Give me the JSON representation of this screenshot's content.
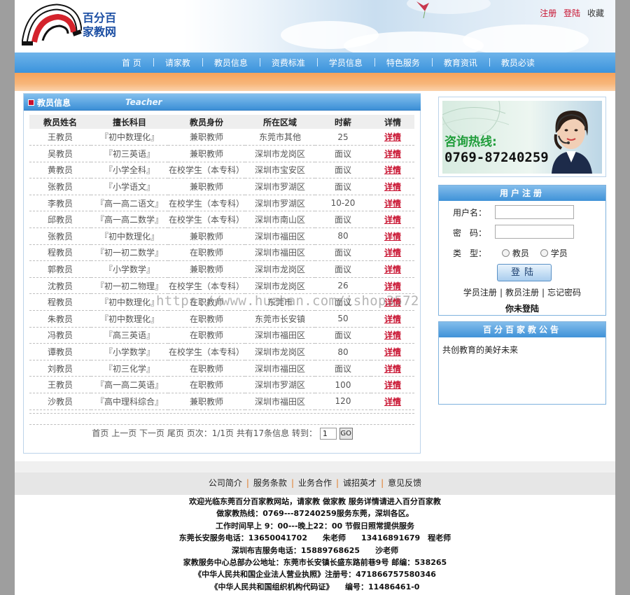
{
  "brand": {
    "line1": "百分百",
    "line2": "家教网"
  },
  "toplinks": {
    "register": "注册",
    "login": "登陆",
    "favorite": "收藏"
  },
  "nav": [
    "首 页",
    "请家教",
    "教员信息",
    "资费标准",
    "学员信息",
    "特色服务",
    "教育资讯",
    "教员必读"
  ],
  "panel": {
    "title": "教员信息",
    "subtitle": "Teacher"
  },
  "table": {
    "headers": [
      "教员姓名",
      "擅长科目",
      "教员身份",
      "所在区域",
      "时薪",
      "详情"
    ],
    "detail_label": "详情",
    "rows": [
      [
        "王教员",
        "『初中数理化』",
        "兼职教师",
        "东莞市其他",
        "25"
      ],
      [
        "吴教员",
        "『初三英语』",
        "兼职教师",
        "深圳市龙岗区",
        "面议"
      ],
      [
        "黄教员",
        "『小学全科』",
        "在校学生（本专科）",
        "深圳市宝安区",
        "面议"
      ],
      [
        "张教员",
        "『小学语文』",
        "兼职教师",
        "深圳市罗湖区",
        "面议"
      ],
      [
        "李教员",
        "『高一高二语文』",
        "在校学生（本专科）",
        "深圳市罗湖区",
        "10-20"
      ],
      [
        "邱教员",
        "『高一高二数学』",
        "在校学生（本专科）",
        "深圳市南山区",
        "面议"
      ],
      [
        "张教员",
        "『初中数理化』",
        "兼职教师",
        "深圳市福田区",
        "80"
      ],
      [
        "程教员",
        "『初一初二数学』",
        "在职教师",
        "深圳市福田区",
        "面议"
      ],
      [
        "郭教员",
        "『小学数学』",
        "兼职教师",
        "深圳市龙岗区",
        "面议"
      ],
      [
        "沈教员",
        "『初一初二物理』",
        "在校学生（本专科）",
        "深圳市龙岗区",
        "26"
      ],
      [
        "程教员",
        "『初中数理化』",
        "在职教师",
        "东莞市",
        "面议"
      ],
      [
        "朱教员",
        "『初中数理化』",
        "在职教师",
        "东莞市长安镇",
        "50"
      ],
      [
        "冯教员",
        "『高三英语』",
        "在职教师",
        "深圳市福田区",
        "面议"
      ],
      [
        "谭教员",
        "『小学数学』",
        "在校学生（本专科）",
        "深圳市龙岗区",
        "80"
      ],
      [
        "刘教员",
        "『初三化学』",
        "在职教师",
        "深圳市福田区",
        "面议"
      ],
      [
        "王教员",
        "『高一高二英语』",
        "在职教师",
        "深圳市罗湖区",
        "100"
      ],
      [
        "沙教员",
        "『高中理科综合』",
        "兼职教师",
        "深圳市福田区",
        "120"
      ]
    ]
  },
  "pager": {
    "first": "首页",
    "prev": "上一页",
    "next": "下一页",
    "last": "尾页",
    "page_info": "页次：1/1页",
    "total": "共有17条信息",
    "goto": "转到：",
    "page_value": "1",
    "go": "GO"
  },
  "hotline": {
    "label": "咨询热线:",
    "number": "0769-87240259"
  },
  "register_box": {
    "title": "用户注册",
    "username_label": "用户名：",
    "password_label": "密　码：",
    "type_label": "类　型：",
    "type_options": [
      "教员",
      "学员"
    ],
    "login_button": "登陆",
    "links": [
      "学员注册",
      "教员注册",
      "忘记密码"
    ],
    "status": "你未登陆"
  },
  "notice_box": {
    "title": "百分百家教公告",
    "body": "共创教育的美好未来"
  },
  "footer_nav": [
    "公司简介",
    "服务条款",
    "业务合作",
    "诚招英才",
    "意见反馈"
  ],
  "footer_info": [
    "欢迎光临东莞百分百家教网站，请家教 做家教 服务详情请进入百分百家教",
    "做家教热线：0769---87240259服务东莞，深圳各区。",
    "工作时间早上 9：00---晚上22：00 节假日照常提供服务",
    "东莞长安服务电话：13650041702　　朱老师　　13416891679　程老师",
    "深圳布吉服务电话：15889768625　　沙老师",
    "家教服务中心总部办公地址：东莞市长安镇长盛东路前巷9号 邮编：538265",
    "《中华人民共和国企业法人营业执照》注册号：471866757580346",
    "《中华人民共和国组织机构代码证》　　编号：11486461-0"
  ],
  "watermark": "https://www.huzhan.com/ishop3572",
  "colors": {
    "nav_blue": "#3b93dc",
    "orange_band": "#f7a25a",
    "link_red": "#c8102e",
    "hotline_green": "#1f9d3a"
  }
}
